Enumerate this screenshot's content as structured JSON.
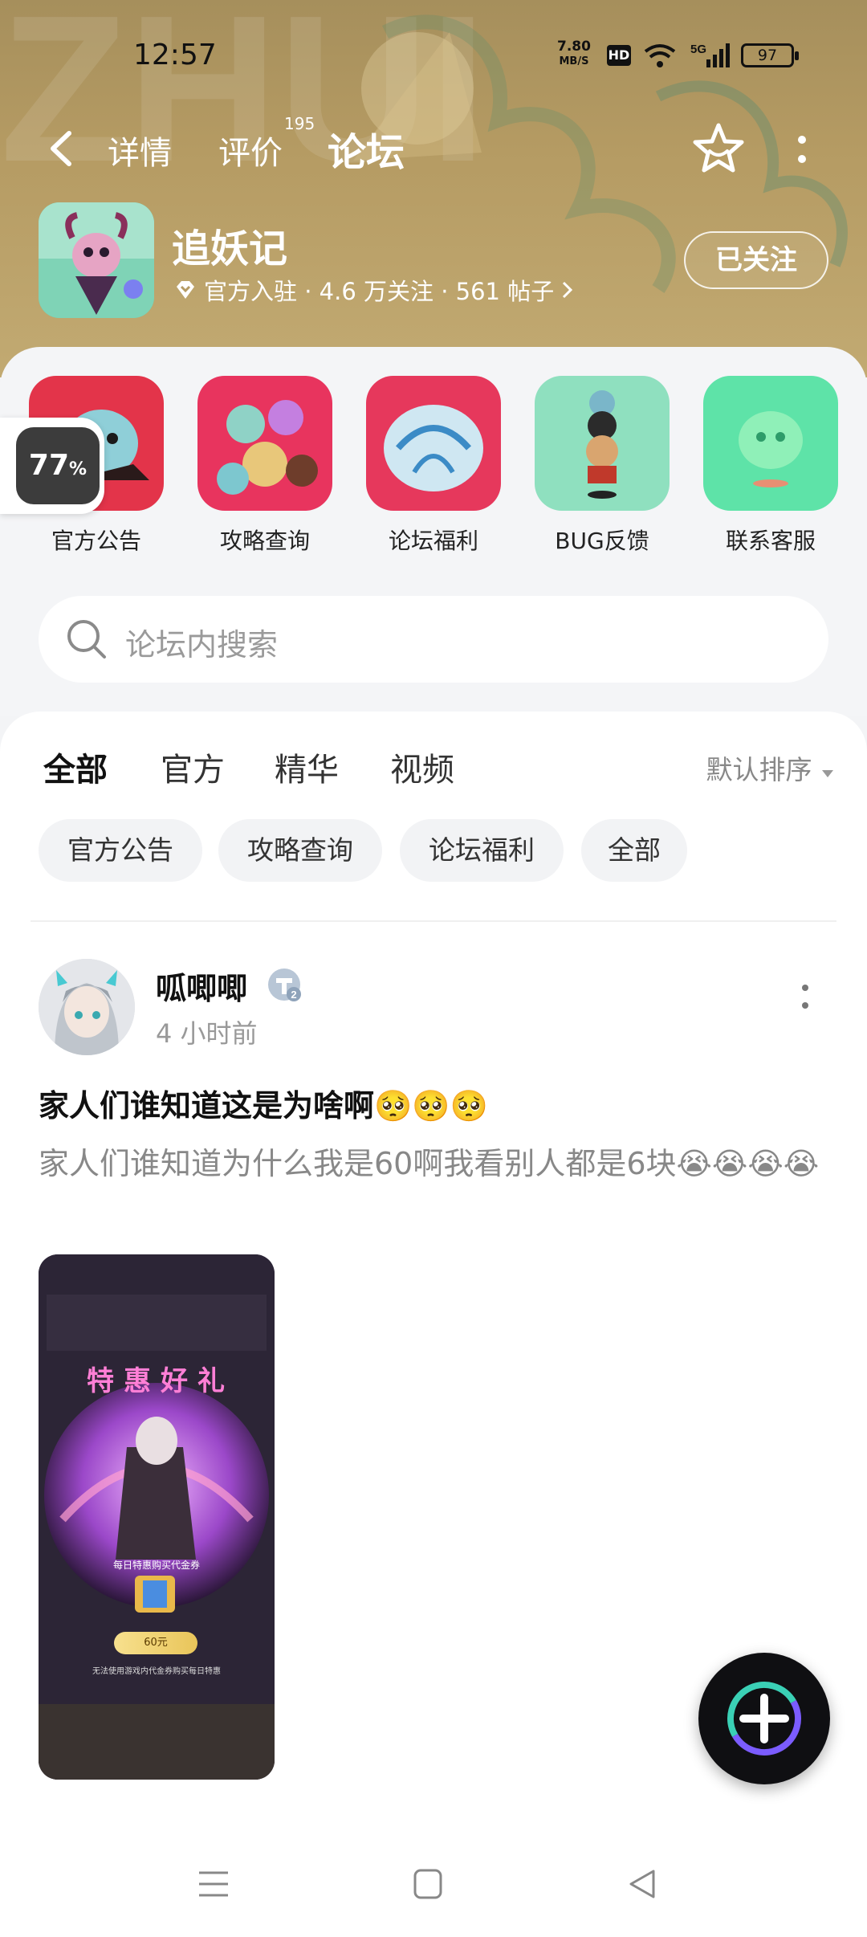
{
  "status_bar": {
    "time": "12:57",
    "net_rate": "7.80",
    "net_unit": "MB/S",
    "hd": "HD",
    "signal": "5G",
    "battery": "97"
  },
  "top_nav": {
    "back_icon": "back-arrow-icon",
    "tabs": [
      {
        "label": "详情"
      },
      {
        "label": "评价",
        "count": "195"
      },
      {
        "label": "论坛",
        "active": true
      }
    ],
    "star_icon": "star-outline-icon",
    "more_icon": "more-vertical-icon"
  },
  "game": {
    "name": "追妖记",
    "meta": "官方入驻 · 4.6 万关注 · 561 帖子",
    "follow_label": "已关注"
  },
  "quick_links": [
    {
      "label": "官方公告"
    },
    {
      "label": "攻略查询"
    },
    {
      "label": "论坛福利"
    },
    {
      "label": "BUG反馈"
    },
    {
      "label": "联系客服"
    }
  ],
  "floating_badge": {
    "value": "77",
    "unit": "%"
  },
  "search": {
    "placeholder": "论坛内搜索"
  },
  "feed": {
    "tabs": [
      "全部",
      "官方",
      "精华",
      "视频"
    ],
    "active_tab": "全部",
    "sort_label": "默认排序",
    "chips": [
      "官方公告",
      "攻略查询",
      "论坛福利",
      "全部"
    ]
  },
  "post": {
    "username": "呱唧唧",
    "level": "2",
    "time": "4 小时前",
    "title": "家人们谁知道这是为啥啊🥺🥺🥺",
    "body": "家人们谁知道为什么我是60啊我看别人都是6块😭😭😭😭",
    "image": {
      "banner": "特惠好礼",
      "line1": "每日特惠购买代金券",
      "price": "60元",
      "line2": "无法使用游戏内代金券购买每日特惠"
    }
  },
  "fab_icon": "plus-icon",
  "nav_bar": {
    "menu_icon": "menu-icon",
    "home_icon": "home-square-icon",
    "back_icon": "back-triangle-icon"
  },
  "colors": {
    "accent": "#3ad0b5",
    "header_bg": "#b59b63"
  }
}
